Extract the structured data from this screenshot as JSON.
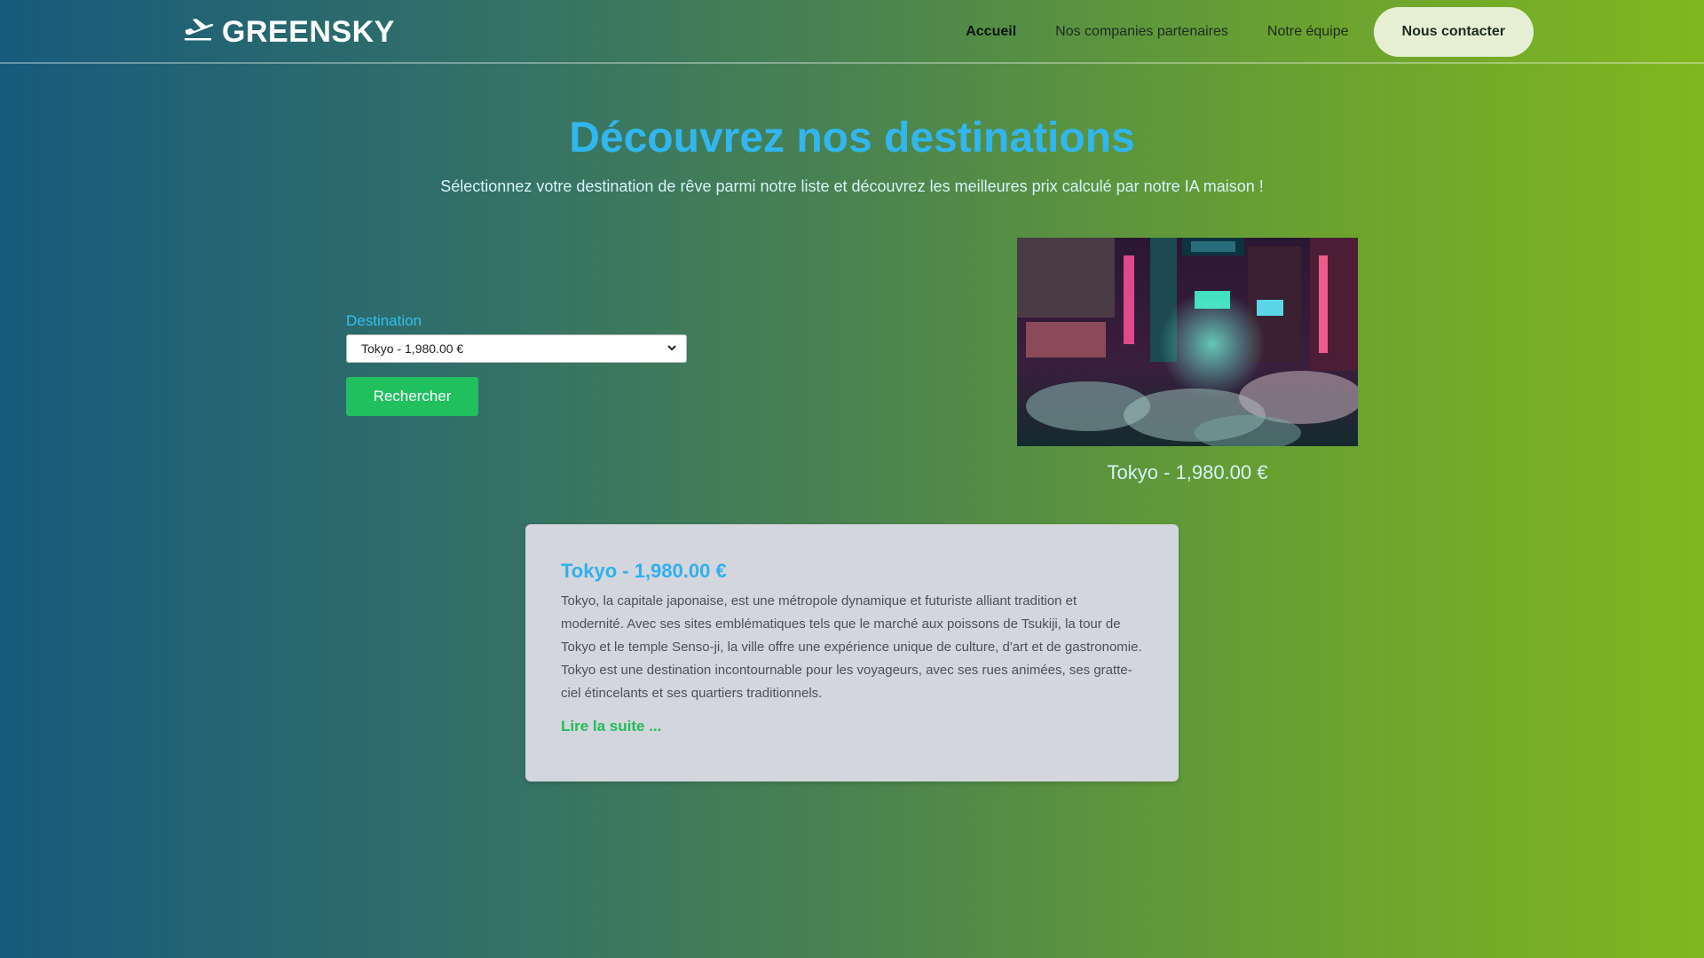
{
  "nav": {
    "brand": "GREENSKY",
    "brand_icon": "plane-departure-icon",
    "links": [
      "Accueil",
      "Nos companies partenaires",
      "Notre équipe"
    ],
    "active": "Accueil",
    "contact_label": "Nous contacter"
  },
  "hero": {
    "title": "Découvrez nos destinations",
    "subtitle": "Sélectionnez votre destination de rêve parmi notre liste et découvrez les meilleures prix calculé par notre IA maison !"
  },
  "form": {
    "label": "Destination",
    "selected": "Tokyo - 1,980.00 €",
    "submit_label": "Rechercher"
  },
  "preview": {
    "image_alt": "Tokyo night street with umbrellas",
    "caption": "Tokyo - 1,980.00 €"
  },
  "card": {
    "title": "Tokyo - 1,980.00 €",
    "description": "Tokyo, la capitale japonaise, est une métropole dynamique et futuriste alliant tradition et modernité. Avec ses sites emblématiques tels que le marché aux poissons de Tsukiji, la tour de Tokyo et le temple Senso-ji, la ville offre une expérience unique de culture, d'art et de gastronomie. Tokyo est une destination incontournable pour les voyageurs, avec ses rues animées, ses gratte-ciel étincelants et ses quartiers traditionnels.",
    "read_more": "Lire la suite ..."
  },
  "colors": {
    "accent_blue": "#31b6ef",
    "accent_green": "#20c05f",
    "gradient_start": "#175a7c",
    "gradient_end": "#80b71f"
  }
}
